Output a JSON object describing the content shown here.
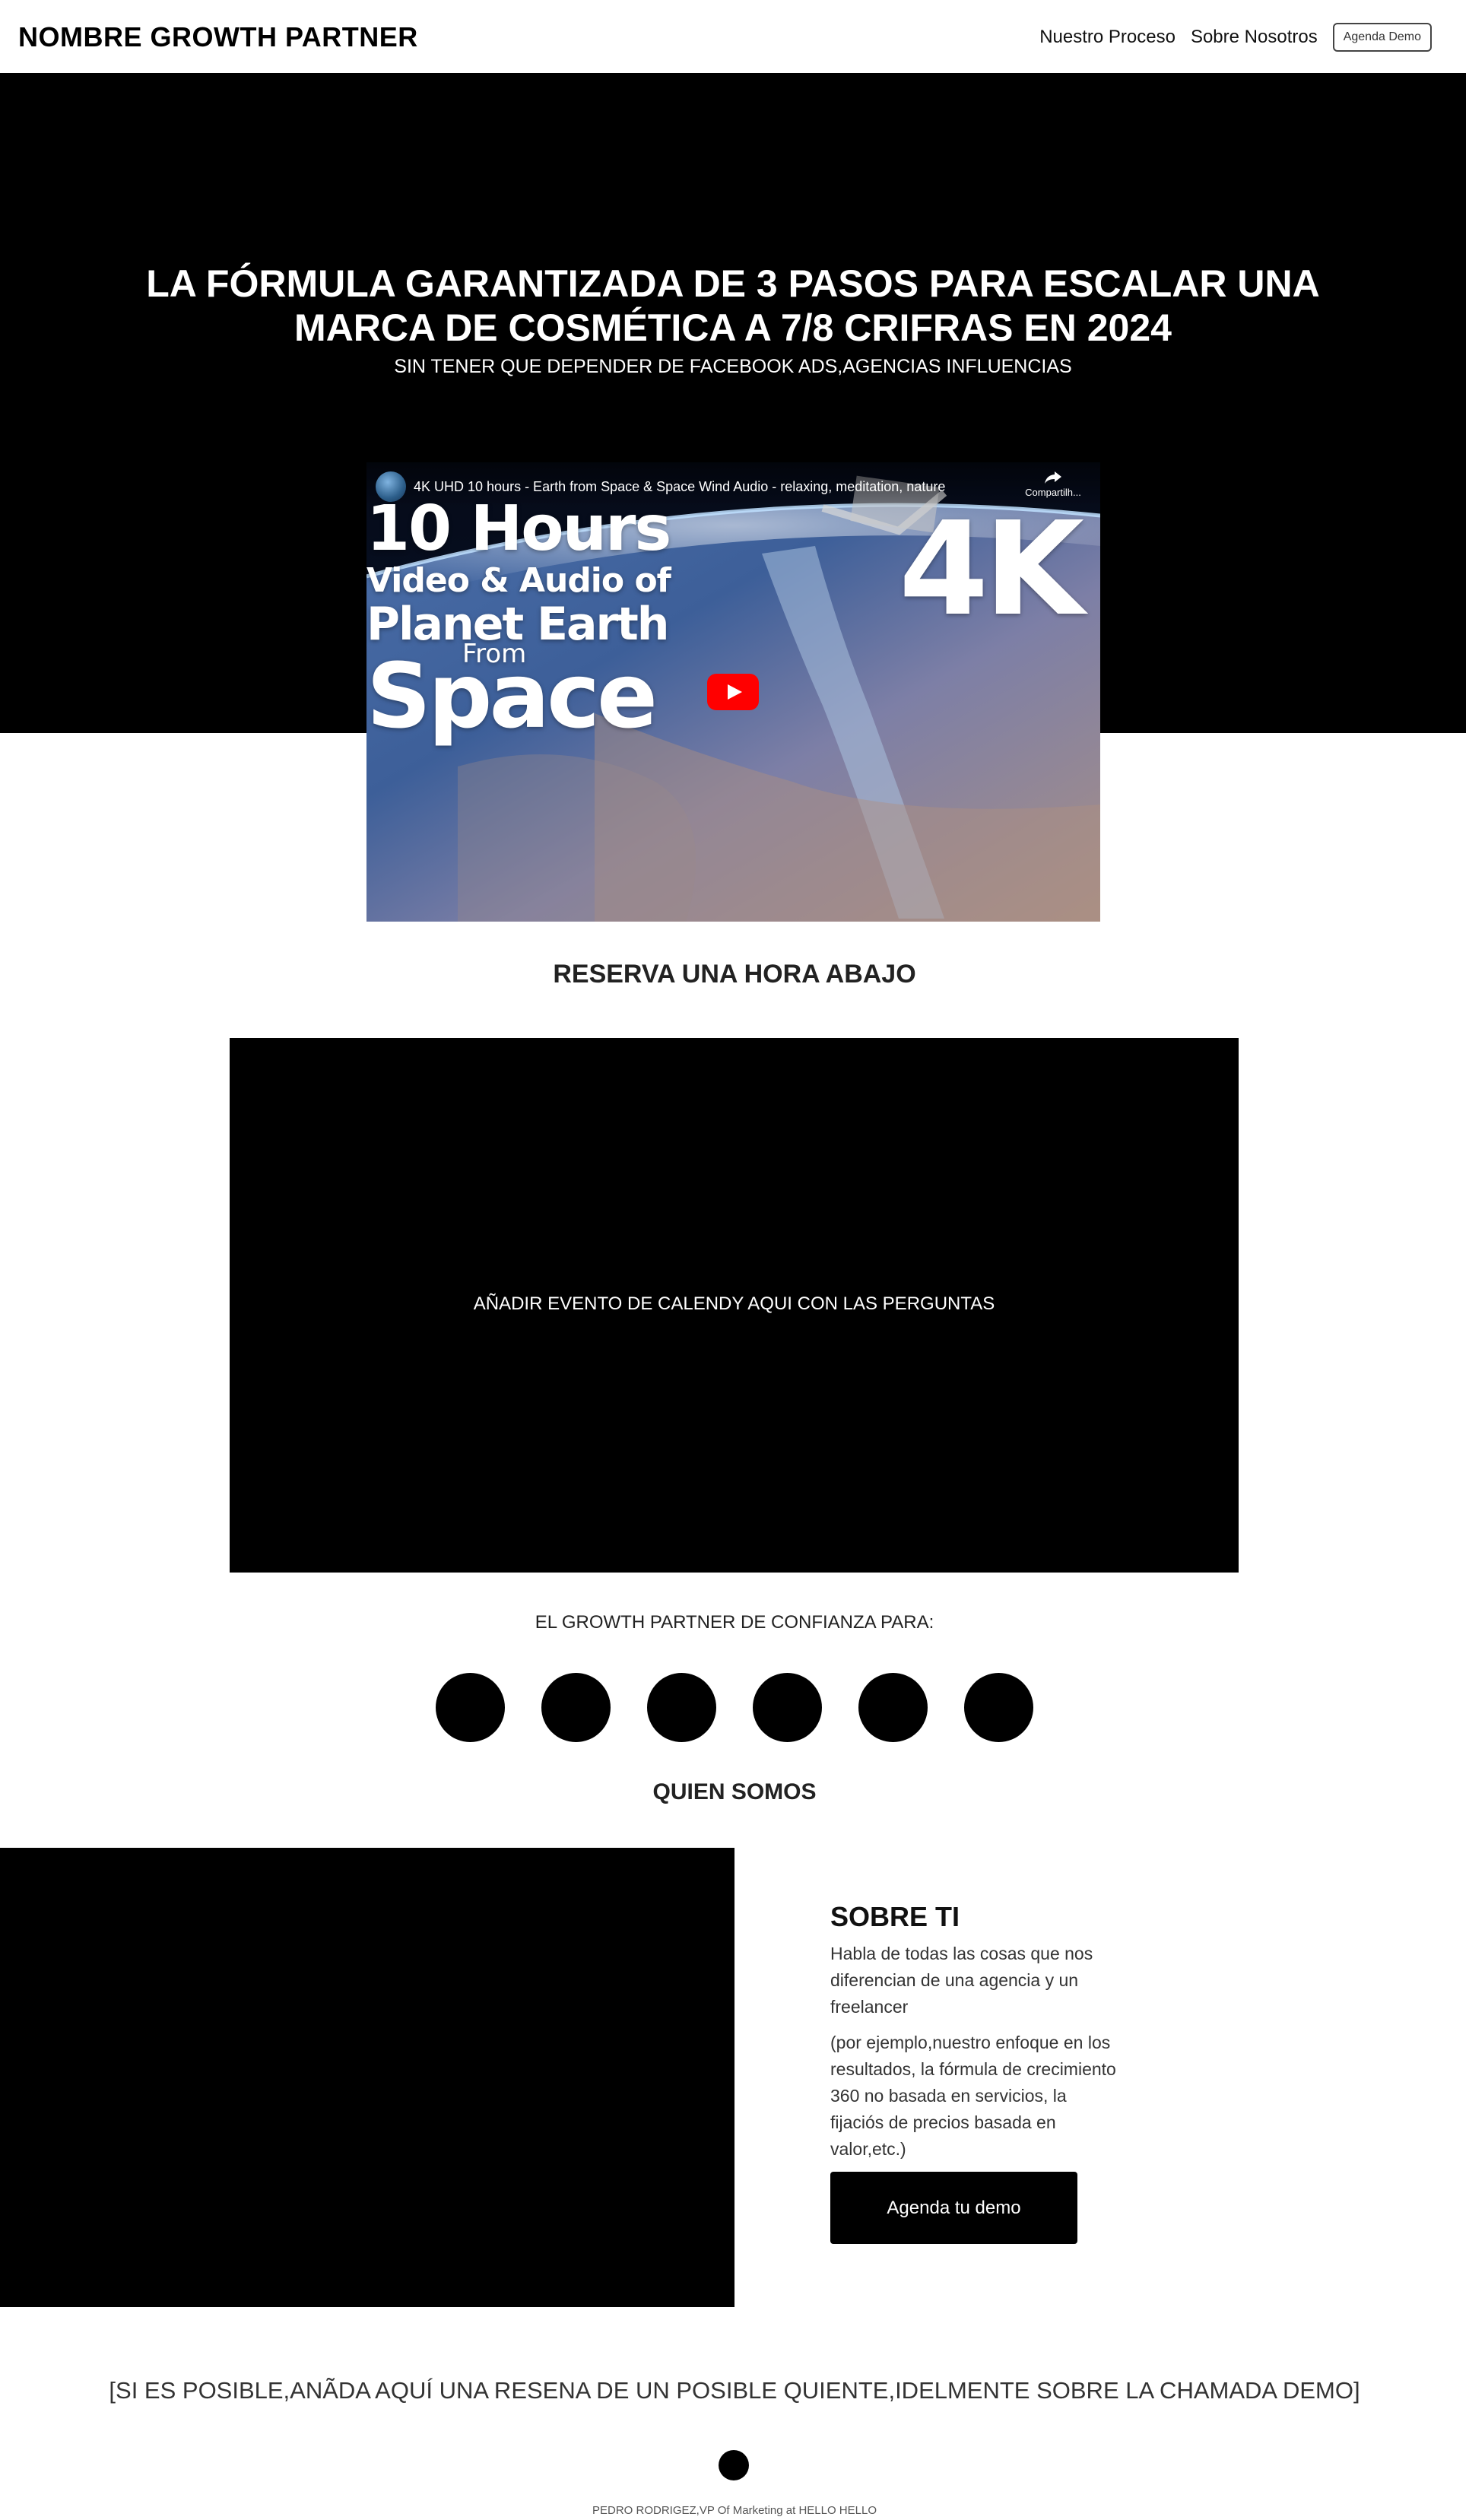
{
  "header": {
    "brand": "NOMBRE GROWTH PARTNER",
    "nav": {
      "process_label": "Nuestro Proceso",
      "about_label": "Sobre Nosotros",
      "demo_button_label": "Agenda Demo"
    }
  },
  "hero": {
    "title_line1": "LA FÓRMULA GARANTIZADA DE 3 PASOS PARA ESCALAR UNA",
    "title_line2": "MARCA DE COSMÉTICA A 7/8 CRIFRAS EN 2024",
    "subtitle": "SIN TENER QUE DEPENDER DE FACEBOOK ADS,AGENCIAS INFLUENCIAS"
  },
  "video": {
    "title": "4K UHD 10 hours - Earth from Space & Space Wind Audio - relaxing, meditation, nature",
    "share_label": "Compartilh...",
    "thumbnail": {
      "line1": "10 Hours",
      "line2": "Video & Audio of",
      "line3": "Planet Earth",
      "line4": "From",
      "line5": "Space",
      "badge": "4K"
    },
    "play_icon": "youtube-play-icon",
    "share_icon": "share-arrow-icon",
    "play_button_color": "#ff0000"
  },
  "reserve": {
    "heading": "RESERVA UNA HORA ABAJO",
    "calendly_placeholder": "AÑADIR EVENTO DE CALENDY AQUI CON LAS PERGUNTAS"
  },
  "trust": {
    "heading": "EL GROWTH PARTNER DE CONFIANZA PARA:",
    "logo_count": 6
  },
  "about": {
    "section_heading": "QUIEN SOMOS",
    "title": "SOBRE TI",
    "paragraph1": "Habla de todas las cosas que nos diferencian de una agencia y un freelancer",
    "paragraph2": "(por ejemplo,nuestro enfoque en los resultados, la fórmula de crecimiento 360 no basada en servicios, la fijaciós de precios basada en valor,etc.)",
    "cta_label": "Agenda tu demo"
  },
  "testimonial": {
    "quote": "[SI ES POSIBLE,ANÃDA AQUÍ UNA RESENA DE UN POSIBLE QUIENTE,IDELMENTE SOBRE LA CHAMADA DEMO]",
    "author": "PEDRO RODRIGEZ,VP Of Marketing at HELLO HELLO"
  },
  "colors": {
    "hero_background": "#000000",
    "cta_background": "#000000",
    "text": "#222222"
  }
}
